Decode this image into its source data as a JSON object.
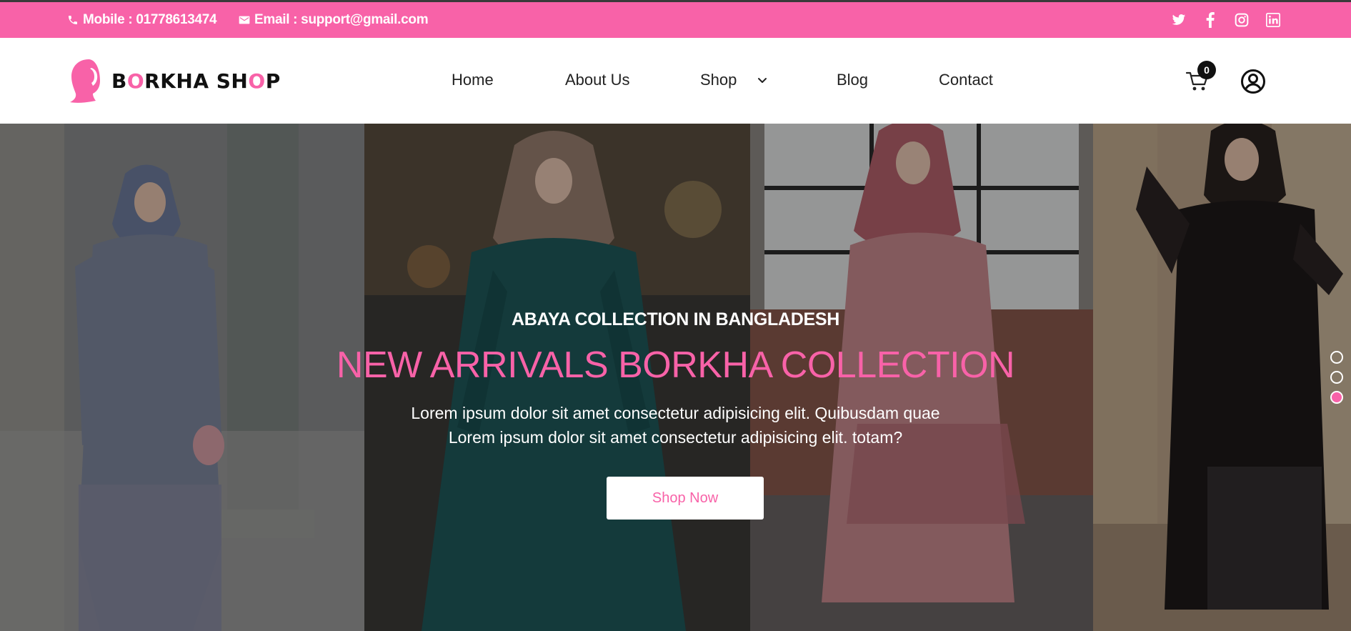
{
  "topbar": {
    "mobile": "Mobile : 01778613474",
    "email": "Email : support@gmail.com",
    "social_icons": [
      "twitter-icon",
      "facebook-icon",
      "instagram-icon",
      "linkedin-icon"
    ]
  },
  "header": {
    "logo": {
      "text_parts": [
        "B",
        "O",
        "RKHA SH",
        "O",
        "P"
      ]
    },
    "nav": {
      "home": "Home",
      "about": "About Us",
      "shop": "Shop",
      "blog": "Blog",
      "contact": "Contact"
    },
    "cart_count": "0"
  },
  "hero": {
    "subtitle": "ABAYA COLLECTION IN BANGLADESH",
    "title": "NEW ARRIVALS BORKHA COLLECTION",
    "description_line1": "Lorem ipsum dolor sit amet consectetur adipisicing elit. Quibusdam quae",
    "description_line2": "Lorem ipsum dolor sit amet consectetur adipisicing elit. totam?",
    "button": "Shop Now",
    "slides": 3,
    "active_slide": 3
  },
  "colors": {
    "brand_pink": "#f862a8",
    "topbar_text": "#ffffff",
    "nav_text": "#222222"
  }
}
